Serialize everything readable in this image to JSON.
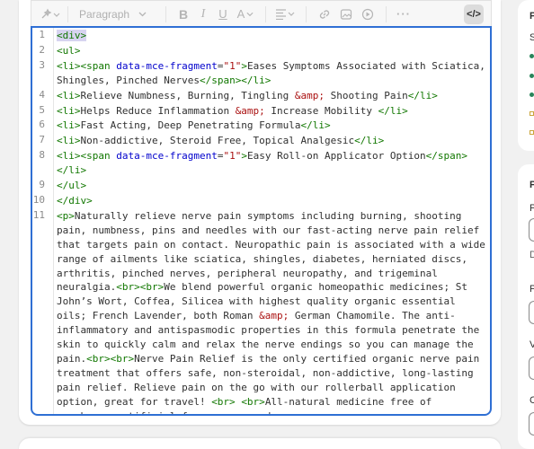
{
  "toolbar": {
    "format_label": "Paragraph",
    "code_label": "</>"
  },
  "editor": {
    "lines": [
      {
        "n": "1",
        "html": "<span class=\"tag sel\">&lt;div&gt;</span>"
      },
      {
        "n": "2",
        "html": "<span class=\"tag\">&lt;ul&gt;</span>"
      },
      {
        "n": "3",
        "html": "<span class=\"tag\">&lt;li&gt;&lt;span</span> <span class=\"attr\">data-mce-fragment</span>=<span class=\"str\">\"1\"</span><span class=\"tag\">&gt;</span>Eases Symptoms Associated with Sciatica, Shingles, Pinched Nerves<span class=\"tag\">&lt;/span&gt;&lt;/li&gt;</span>"
      },
      {
        "n": "4",
        "html": "<span class=\"tag\">&lt;li&gt;</span>Relieve Numbness, Burning, Tingling <span class=\"ent\">&amp;amp;</span> Shooting Pain<span class=\"tag\">&lt;/li&gt;</span>"
      },
      {
        "n": "5",
        "html": "<span class=\"tag\">&lt;li&gt;</span>Helps Reduce Inflammation <span class=\"ent\">&amp;amp;</span> Increase Mobility <span class=\"tag\">&lt;/li&gt;</span>"
      },
      {
        "n": "6",
        "html": "<span class=\"tag\">&lt;li&gt;</span>Fast Acting, Deep Penetrating Formula<span class=\"tag\">&lt;/li&gt;</span>"
      },
      {
        "n": "7",
        "html": "<span class=\"tag\">&lt;li&gt;</span>Non-addictive, Steroid Free, Topical Analgesic<span class=\"tag\">&lt;/li&gt;</span>"
      },
      {
        "n": "8",
        "html": "<span class=\"tag\">&lt;li&gt;&lt;span</span> <span class=\"attr\">data-mce-fragment</span>=<span class=\"str\">\"1\"</span><span class=\"tag\">&gt;</span>Easy Roll-on Applicator Option<span class=\"tag\">&lt;/span&gt;</span> <span class=\"tag\">&lt;/li&gt;</span>"
      },
      {
        "n": "9",
        "html": "<span class=\"tag\">&lt;/ul&gt;</span>"
      },
      {
        "n": "10",
        "html": "<span class=\"tag\">&lt;/div&gt;</span>"
      },
      {
        "n": "11",
        "html": "<span class=\"tag\">&lt;p&gt;</span>Naturally relieve nerve pain symptoms including burning, shooting pain, numbness, pins and needles with our fast-acting nerve pain relief that targets pain on contact. Neuropathic pain is associated with a wide range of ailments like sciatica, shingles, diabetes, herniated discs, arthritis, pinched nerves, peripheral neuropathy, and trigeminal neuralgia.<span class=\"tag\">&lt;br&gt;&lt;br&gt;</span>We blend powerful organic homeopathic medicines; St John’s Wort, Coffea, Silicea with highest quality organic essential oils; French Lavender, both Roman <span class=\"ent\">&amp;amp;</span> German Chamomile. The anti-inflammatory and antispasmodic properties in this formula penetrate the skin to quickly calm and relax the nerve endings so you can manage the pain.<span class=\"tag\">&lt;br&gt;&lt;br&gt;</span>Nerve Pain Relief is the only certified organic nerve pain treatment that offers safe, non-steroidal, non-addictive, long-lasting pain relief. Relieve pain on the go with our rollerball application option, great for travel! <span class=\"tag\">&lt;br&gt;</span> <span class=\"tag\">&lt;br&gt;</span>All-natural medicine free of parabens, artificial fragrances, and"
      }
    ]
  },
  "side": {
    "top_letter": "P",
    "s_letter": "S",
    "p2_letter": "P",
    "p3_letter": "P",
    "d_letter": "D",
    "p4_letter": "P",
    "v_letter": "V",
    "c_letter": "C"
  }
}
